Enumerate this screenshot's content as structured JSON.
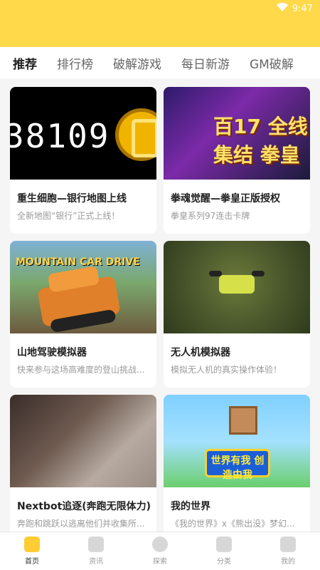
{
  "status_bar": {
    "time": "9:47",
    "icons": [
      "wifi-icon",
      "battery-icon"
    ]
  },
  "tabs": [
    {
      "label": "推荐",
      "active": true
    },
    {
      "label": "排行榜",
      "active": false
    },
    {
      "label": "破解游戏",
      "active": false
    },
    {
      "label": "每日新游",
      "active": false
    },
    {
      "label": "GM破解",
      "active": false
    }
  ],
  "cards": [
    {
      "title": "重生细胞—银行地图上线",
      "desc": "全新地图“银行”正式上线！",
      "thumb_text": "38109"
    },
    {
      "title": "拳魂觉醒—拳皇正版授权",
      "desc": "拳皇系列97连击卡牌",
      "thumb_text": "百17 全线集结 拳皇"
    },
    {
      "title": "山地驾驶模拟器",
      "desc": "快来参与这场高难度的登山挑战...",
      "thumb_text": "MOUNTAIN CAR DRIVE"
    },
    {
      "title": "无人机模拟器",
      "desc": "模拟无人机的真实操作体验！",
      "thumb_text": ""
    },
    {
      "title": "Nextbot追逐(奔跑无限体力)",
      "desc": "奔跑和跳跃以逃离他们并收集所...",
      "thumb_text": ""
    },
    {
      "title": "我的世界",
      "desc": "《我的世界》x《熊出没》梦幻...",
      "thumb_text": "世界有我 创造由我"
    }
  ],
  "bottom_nav": [
    {
      "label": "首页",
      "icon": "home-icon",
      "active": true
    },
    {
      "label": "资讯",
      "icon": "news-icon",
      "active": false
    },
    {
      "label": "探索",
      "icon": "compass-icon",
      "active": false
    },
    {
      "label": "分类",
      "icon": "category-icon",
      "active": false
    },
    {
      "label": "我的",
      "icon": "profile-icon",
      "active": false
    }
  ],
  "colors": {
    "header_yellow": "#ffd94a",
    "accent": "#ffcc33"
  }
}
